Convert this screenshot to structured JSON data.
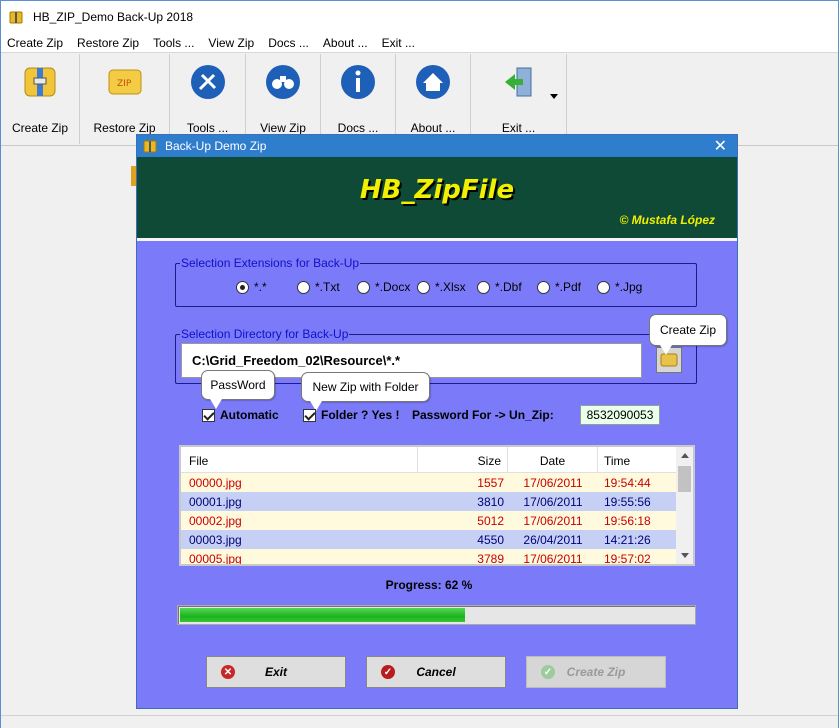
{
  "window": {
    "title": "HB_ZIP_Demo Back-Up 2018"
  },
  "menu": [
    "Create Zip",
    "Restore Zip",
    "Tools ...",
    "View Zip",
    "Docs ...",
    "About ...",
    "Exit ..."
  ],
  "toolbar": {
    "create_zip": "Create Zip",
    "restore_zip": "Restore Zip",
    "tools": "Tools ...",
    "view_zip": "View Zip",
    "docs": "Docs ...",
    "about": "About ...",
    "exit": "Exit ..."
  },
  "dialog": {
    "title": "Back-Up Demo Zip",
    "close": "✕",
    "banner_title": "HB_ZipFile",
    "banner_credit": "©  Mustafa López",
    "extensions": {
      "legend": "Selection Extensions for Back-Up",
      "options": [
        "*.*",
        "*.Txt",
        "*.Docx",
        "*.Xlsx",
        "*.Dbf",
        "*.Pdf",
        "*.Jpg"
      ],
      "selected": "*.*"
    },
    "directory": {
      "legend": "Selection Directory for Back-Up",
      "path": "C:\\Grid_Freedom_02\\Resource\\*.*"
    },
    "tooltips": {
      "create_zip": "Create Zip",
      "password": "PassWord",
      "new_zip_folder": "New Zip with Folder"
    },
    "automatic_label": "Automatic",
    "folder_label": "Folder ? Yes !",
    "password_label": "Password  For -> Un_Zip:",
    "password_value": "8532090053",
    "file_list": {
      "headers": [
        "File",
        "Size",
        "Date",
        "Time"
      ],
      "rows": [
        {
          "file": "00000.jpg",
          "size": "1557",
          "date": "17/06/2011",
          "time": "19:54:44"
        },
        {
          "file": "00001.jpg",
          "size": "3810",
          "date": "17/06/2011",
          "time": "19:55:56"
        },
        {
          "file": "00002.jpg",
          "size": "5012",
          "date": "17/06/2011",
          "time": "19:56:18"
        },
        {
          "file": "00003.jpg",
          "size": "4550",
          "date": "26/04/2011",
          "time": "14:21:26"
        },
        {
          "file": "00005.jpg",
          "size": "3789",
          "date": "17/06/2011",
          "time": "19:57:02"
        }
      ]
    },
    "progress_label": "Progress:  62 %",
    "progress_value": 0.555,
    "buttons": {
      "exit": "Exit",
      "cancel": "Cancel",
      "create_zip": "Create Zip"
    }
  },
  "colors": {
    "dialog_bg": "#7b7bfa",
    "banner_bg": "#0f4a36",
    "banner_text": "#f0f000",
    "row_yellow": "#fffadd",
    "row_blue": "#c6d0f4",
    "progress_green": "#1db31d"
  }
}
